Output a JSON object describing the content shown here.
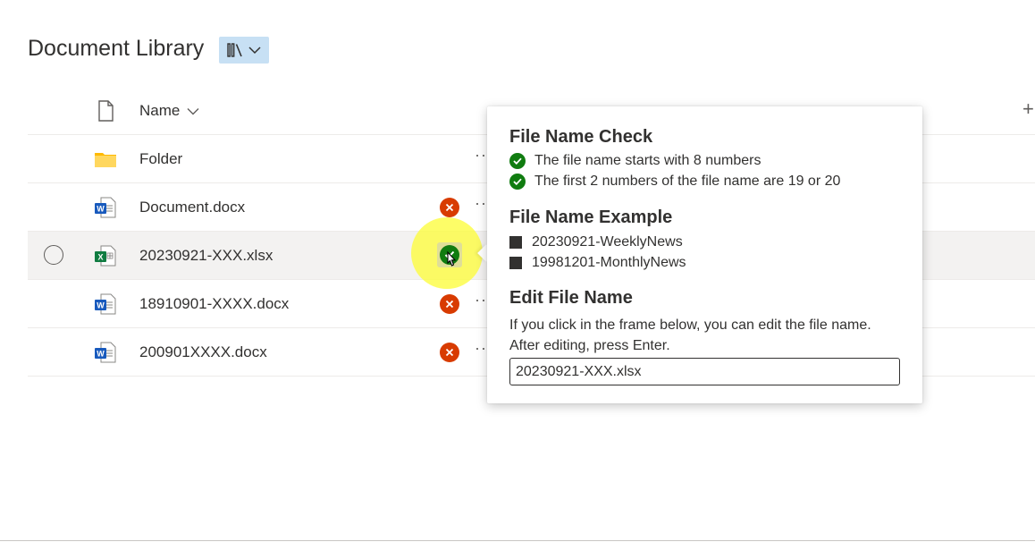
{
  "library": {
    "title": "Document Library",
    "view_icon": "library-icon"
  },
  "columns": {
    "name": "Name",
    "add_icon": "+"
  },
  "rows": [
    {
      "name": "Folder",
      "type": "folder",
      "status": "none",
      "more": "··"
    },
    {
      "name": "Document.docx",
      "type": "word",
      "status": "error",
      "more": "··"
    },
    {
      "name": "20230921-XXX.xlsx",
      "type": "excel",
      "status": "ok",
      "more": ""
    },
    {
      "name": "18910901-XXXX.docx",
      "type": "word",
      "status": "error",
      "more": "··"
    },
    {
      "name": "200901XXXX.docx",
      "type": "word",
      "status": "error",
      "more": "··"
    }
  ],
  "callout": {
    "check_title": "File Name Check",
    "checks": [
      "The file name starts with 8 numbers",
      "The first 2 numbers of the file name are 19 or 20"
    ],
    "example_title": "File Name Example",
    "examples": [
      "20230921-WeeklyNews",
      "19981201-MonthlyNews"
    ],
    "edit_title": "Edit File Name",
    "edit_desc": "If you click in the frame below, you can edit the file name. After editing, press Enter.",
    "edit_value": "20230921-XXX.xlsx"
  },
  "colors": {
    "error": "#d83b01",
    "ok": "#107c10",
    "view_switch_bg": "#c7e0f4",
    "highlight": "#fcfc3c"
  }
}
